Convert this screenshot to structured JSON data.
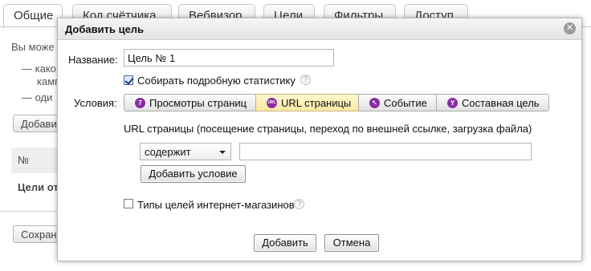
{
  "background": {
    "tabs": [
      {
        "label": "Общие",
        "active": true
      },
      {
        "label": "Код счётчика",
        "active": false
      },
      {
        "label": "Вебвизор",
        "active": false
      },
      {
        "label": "Цели",
        "active": false
      },
      {
        "label": "Фильтры",
        "active": false
      },
      {
        "label": "Доступ",
        "active": false
      }
    ],
    "intro_text": "Вы може",
    "bullet_1a": "— како",
    "bullet_1b": "камп",
    "bullet_2": "— оди",
    "add_button": "Добави",
    "table_header": "№",
    "table_row": "Цели от",
    "save_button": "Сохран"
  },
  "dialog": {
    "title": "Добавить цель",
    "close_icon": "close-icon",
    "name_label": "Название:",
    "name_value": "Цель № 1",
    "collect_stats_label": "Собирать подробную статистику",
    "collect_stats_checked": true,
    "conditions_label": "Условия:",
    "condition_types": [
      {
        "label": "Просмотры страниц",
        "icon": "pageviews-icon",
        "glyph": "7",
        "active": false
      },
      {
        "label": "URL страницы",
        "icon": "url-icon",
        "glyph": "URL",
        "active": true
      },
      {
        "label": "Событие",
        "icon": "event-icon",
        "glyph": "↖",
        "active": false
      },
      {
        "label": "Составная цель",
        "icon": "composite-goal-icon",
        "glyph": "Y",
        "active": false
      }
    ],
    "url_description": "URL страницы (посещение страницы, переход по внешней ссылке, загрузка файла)",
    "match_select_value": "содержит",
    "url_input_value": "",
    "add_condition_button": "Добавить условие",
    "ecommerce_label": "Типы целей интернет-магазинов",
    "ecommerce_checked": false,
    "submit_button": "Добавить",
    "cancel_button": "Отмена",
    "help_glyph": "?"
  },
  "colors": {
    "active_segment": "#fbe9a4",
    "icon_purple": "#8a2ea3",
    "dialog_border": "#b9b9b9"
  }
}
